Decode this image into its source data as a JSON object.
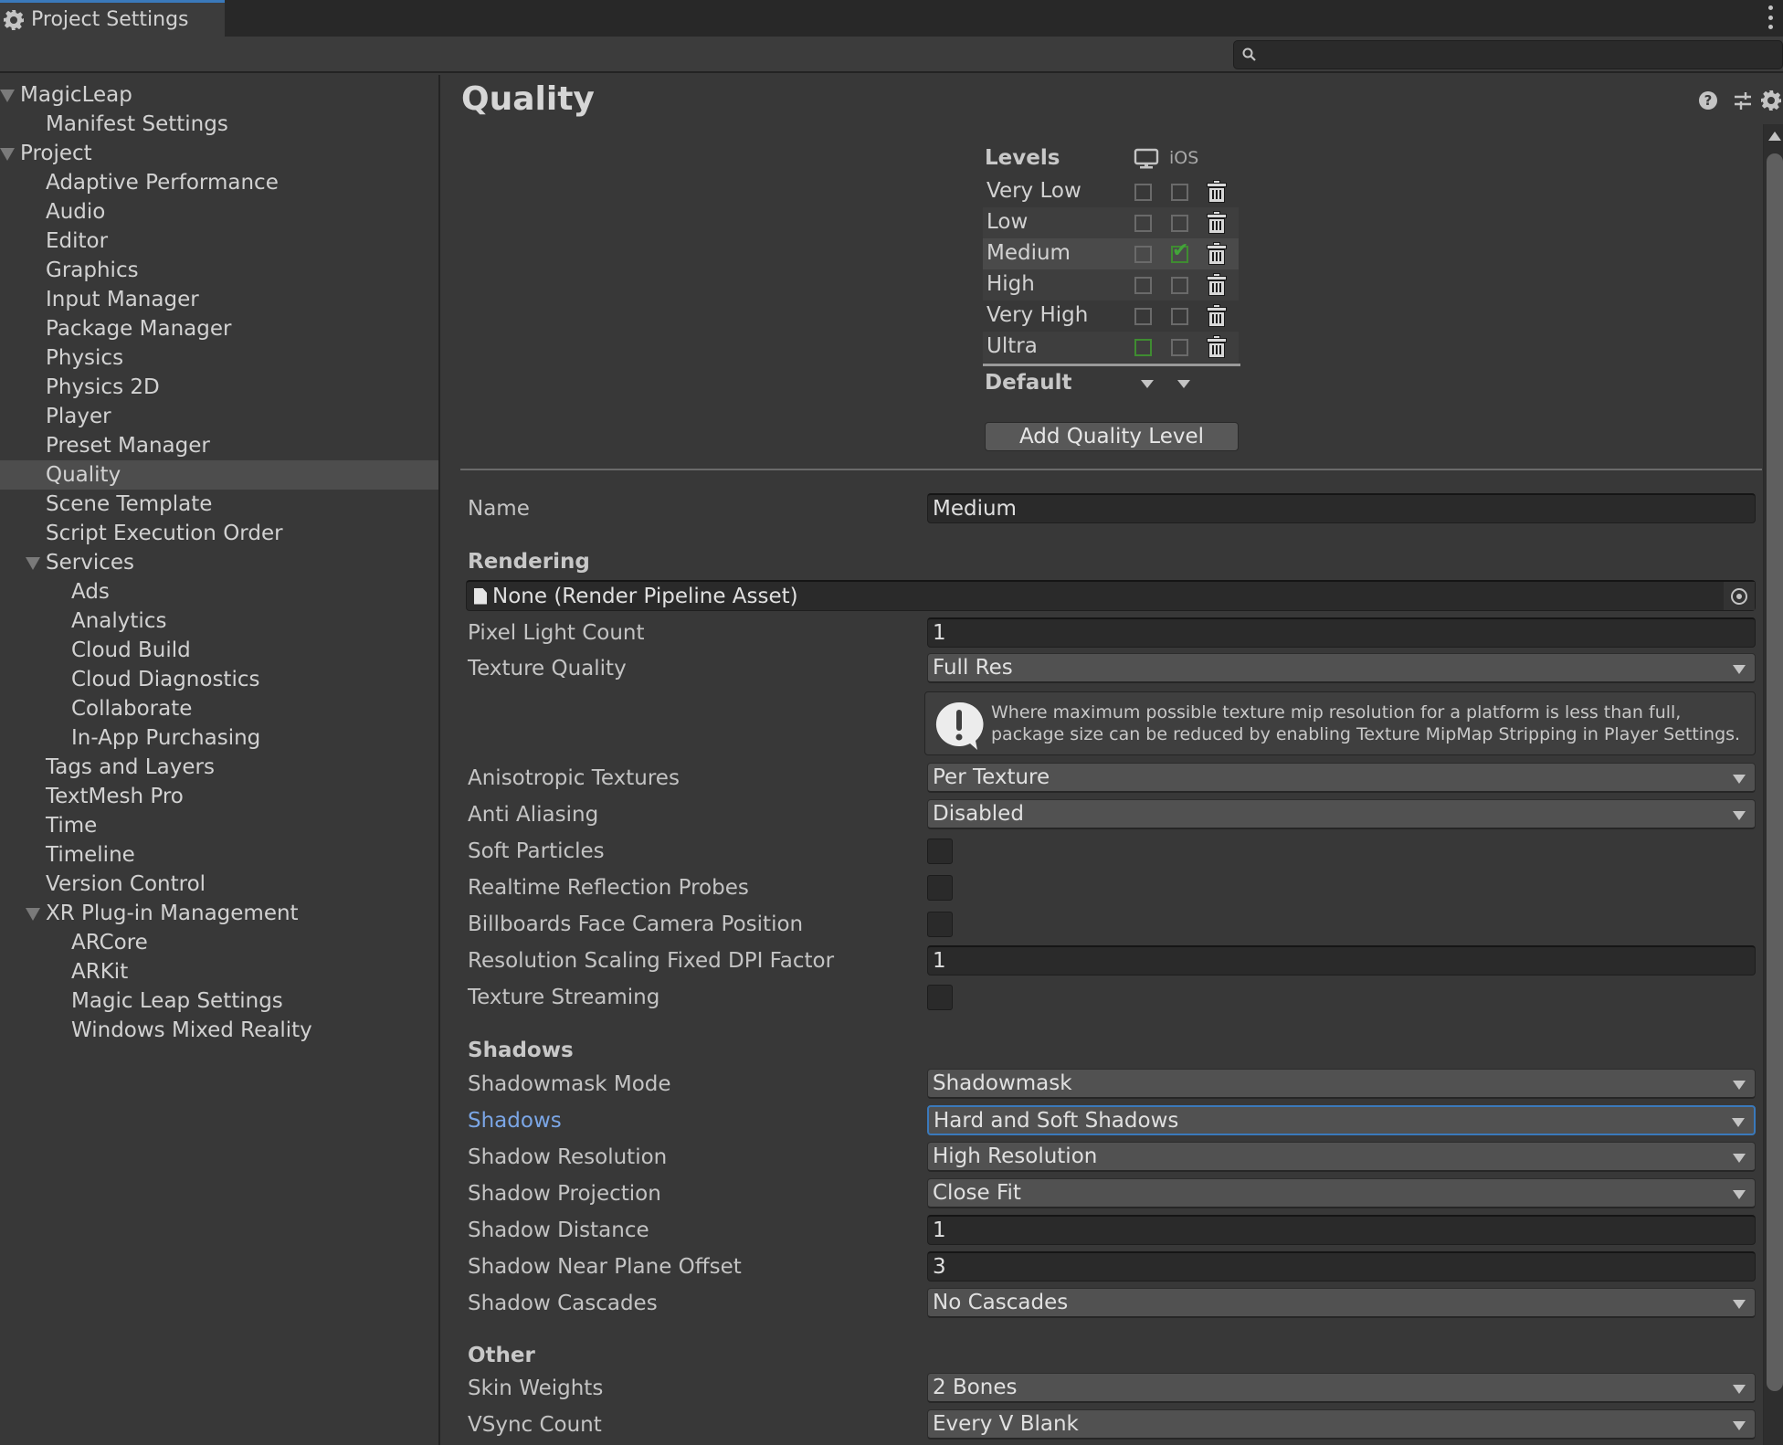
{
  "window": {
    "tab_label": "Project Settings",
    "search_placeholder": "",
    "search_value": ""
  },
  "sidebar": {
    "items": [
      {
        "label": "MagicLeap",
        "level": 0,
        "expandable": true
      },
      {
        "label": "Manifest Settings",
        "level": 1
      },
      {
        "label": "Project",
        "level": 0,
        "expandable": true
      },
      {
        "label": "Adaptive Performance",
        "level": 1
      },
      {
        "label": "Audio",
        "level": 1
      },
      {
        "label": "Editor",
        "level": 1
      },
      {
        "label": "Graphics",
        "level": 1
      },
      {
        "label": "Input Manager",
        "level": 1
      },
      {
        "label": "Package Manager",
        "level": 1
      },
      {
        "label": "Physics",
        "level": 1
      },
      {
        "label": "Physics 2D",
        "level": 1
      },
      {
        "label": "Player",
        "level": 1
      },
      {
        "label": "Preset Manager",
        "level": 1
      },
      {
        "label": "Quality",
        "level": 1,
        "selected": true
      },
      {
        "label": "Scene Template",
        "level": 1
      },
      {
        "label": "Script Execution Order",
        "level": 1
      },
      {
        "label": "Services",
        "level": 1,
        "expandable": true
      },
      {
        "label": "Ads",
        "level": 2
      },
      {
        "label": "Analytics",
        "level": 2
      },
      {
        "label": "Cloud Build",
        "level": 2
      },
      {
        "label": "Cloud Diagnostics",
        "level": 2
      },
      {
        "label": "Collaborate",
        "level": 2
      },
      {
        "label": "In-App Purchasing",
        "level": 2
      },
      {
        "label": "Tags and Layers",
        "level": 1
      },
      {
        "label": "TextMesh Pro",
        "level": 1
      },
      {
        "label": "Time",
        "level": 1
      },
      {
        "label": "Timeline",
        "level": 1
      },
      {
        "label": "Version Control",
        "level": 1
      },
      {
        "label": "XR Plug-in Management",
        "level": 1,
        "expandable": true
      },
      {
        "label": "ARCore",
        "level": 2
      },
      {
        "label": "ARKit",
        "level": 2
      },
      {
        "label": "Magic Leap Settings",
        "level": 2
      },
      {
        "label": "Windows Mixed Reality",
        "level": 2
      }
    ]
  },
  "main": {
    "title": "Quality",
    "header_icons": [
      "help-icon",
      "presets-icon",
      "settings-gear-icon"
    ],
    "levels": {
      "title": "Levels",
      "platforms": [
        {
          "name": "Standalone",
          "icon": "monitor-icon"
        },
        {
          "name": "iOS",
          "label": "iOS"
        }
      ],
      "rows": [
        {
          "name": "Very Low",
          "standalone": false,
          "ios": false
        },
        {
          "name": "Low",
          "standalone": false,
          "ios": false
        },
        {
          "name": "Medium",
          "standalone": false,
          "ios": true,
          "selected": true
        },
        {
          "name": "High",
          "standalone": false,
          "ios": false
        },
        {
          "name": "Very High",
          "standalone": false,
          "ios": false
        },
        {
          "name": "Ultra",
          "standalone": false,
          "ios": false,
          "standalone_default": true
        }
      ],
      "default_label": "Default",
      "add_button": "Add Quality Level"
    },
    "name": {
      "label": "Name",
      "value": "Medium"
    },
    "rendering": {
      "section": "Rendering",
      "pipeline_asset": "None (Render Pipeline Asset)",
      "pixel_light_count": {
        "label": "Pixel Light Count",
        "value": "1"
      },
      "texture_quality": {
        "label": "Texture Quality",
        "value": "Full Res"
      },
      "help_text_line1": "Where maximum possible texture mip resolution for a platform is less than full,",
      "help_text_line2": "package size can be reduced by enabling Texture MipMap Stripping in Player Settings.",
      "anisotropic": {
        "label": "Anisotropic Textures",
        "value": "Per Texture"
      },
      "anti_aliasing": {
        "label": "Anti Aliasing",
        "value": "Disabled"
      },
      "soft_particles": {
        "label": "Soft Particles",
        "checked": false
      },
      "realtime_reflection": {
        "label": "Realtime Reflection Probes",
        "checked": false
      },
      "billboards": {
        "label": "Billboards Face Camera Position",
        "checked": false
      },
      "dpi_factor": {
        "label": "Resolution Scaling Fixed DPI Factor",
        "value": "1"
      },
      "texture_streaming": {
        "label": "Texture Streaming",
        "checked": false
      }
    },
    "shadows": {
      "section": "Shadows",
      "shadowmask_mode": {
        "label": "Shadowmask Mode",
        "value": "Shadowmask"
      },
      "shadows": {
        "label": "Shadows",
        "value": "Hard and Soft Shadows"
      },
      "resolution": {
        "label": "Shadow Resolution",
        "value": "High Resolution"
      },
      "projection": {
        "label": "Shadow Projection",
        "value": "Close Fit"
      },
      "distance": {
        "label": "Shadow Distance",
        "value": "1"
      },
      "near_plane": {
        "label": "Shadow Near Plane Offset",
        "value": "3"
      },
      "cascades": {
        "label": "Shadow Cascades",
        "value": "No Cascades"
      }
    },
    "other": {
      "section": "Other",
      "skin_weights": {
        "label": "Skin Weights",
        "value": "2 Bones"
      },
      "vsync": {
        "label": "VSync Count",
        "value": "Every V Blank"
      }
    }
  },
  "colors": {
    "accent_blue": "#3a79bb",
    "label_highlight": "#7ba6e6",
    "check_green": "#43a33a"
  }
}
